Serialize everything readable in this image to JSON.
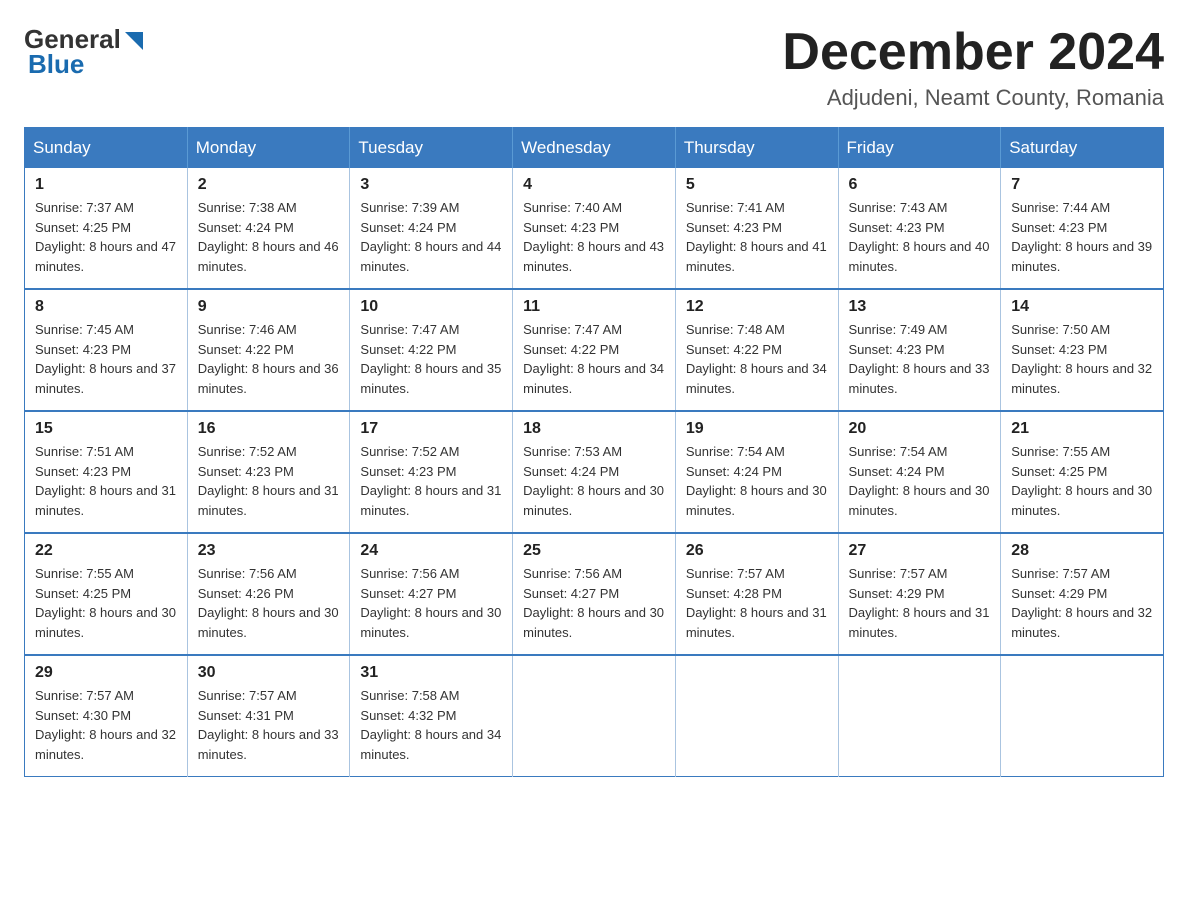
{
  "header": {
    "logo": {
      "general": "General",
      "blue": "Blue"
    },
    "title": "December 2024",
    "location": "Adjudeni, Neamt County, Romania"
  },
  "calendar": {
    "days_of_week": [
      "Sunday",
      "Monday",
      "Tuesday",
      "Wednesday",
      "Thursday",
      "Friday",
      "Saturday"
    ],
    "weeks": [
      [
        {
          "day": "1",
          "sunrise": "7:37 AM",
          "sunset": "4:25 PM",
          "daylight": "8 hours and 47 minutes."
        },
        {
          "day": "2",
          "sunrise": "7:38 AM",
          "sunset": "4:24 PM",
          "daylight": "8 hours and 46 minutes."
        },
        {
          "day": "3",
          "sunrise": "7:39 AM",
          "sunset": "4:24 PM",
          "daylight": "8 hours and 44 minutes."
        },
        {
          "day": "4",
          "sunrise": "7:40 AM",
          "sunset": "4:23 PM",
          "daylight": "8 hours and 43 minutes."
        },
        {
          "day": "5",
          "sunrise": "7:41 AM",
          "sunset": "4:23 PM",
          "daylight": "8 hours and 41 minutes."
        },
        {
          "day": "6",
          "sunrise": "7:43 AM",
          "sunset": "4:23 PM",
          "daylight": "8 hours and 40 minutes."
        },
        {
          "day": "7",
          "sunrise": "7:44 AM",
          "sunset": "4:23 PM",
          "daylight": "8 hours and 39 minutes."
        }
      ],
      [
        {
          "day": "8",
          "sunrise": "7:45 AM",
          "sunset": "4:23 PM",
          "daylight": "8 hours and 37 minutes."
        },
        {
          "day": "9",
          "sunrise": "7:46 AM",
          "sunset": "4:22 PM",
          "daylight": "8 hours and 36 minutes."
        },
        {
          "day": "10",
          "sunrise": "7:47 AM",
          "sunset": "4:22 PM",
          "daylight": "8 hours and 35 minutes."
        },
        {
          "day": "11",
          "sunrise": "7:47 AM",
          "sunset": "4:22 PM",
          "daylight": "8 hours and 34 minutes."
        },
        {
          "day": "12",
          "sunrise": "7:48 AM",
          "sunset": "4:22 PM",
          "daylight": "8 hours and 34 minutes."
        },
        {
          "day": "13",
          "sunrise": "7:49 AM",
          "sunset": "4:23 PM",
          "daylight": "8 hours and 33 minutes."
        },
        {
          "day": "14",
          "sunrise": "7:50 AM",
          "sunset": "4:23 PM",
          "daylight": "8 hours and 32 minutes."
        }
      ],
      [
        {
          "day": "15",
          "sunrise": "7:51 AM",
          "sunset": "4:23 PM",
          "daylight": "8 hours and 31 minutes."
        },
        {
          "day": "16",
          "sunrise": "7:52 AM",
          "sunset": "4:23 PM",
          "daylight": "8 hours and 31 minutes."
        },
        {
          "day": "17",
          "sunrise": "7:52 AM",
          "sunset": "4:23 PM",
          "daylight": "8 hours and 31 minutes."
        },
        {
          "day": "18",
          "sunrise": "7:53 AM",
          "sunset": "4:24 PM",
          "daylight": "8 hours and 30 minutes."
        },
        {
          "day": "19",
          "sunrise": "7:54 AM",
          "sunset": "4:24 PM",
          "daylight": "8 hours and 30 minutes."
        },
        {
          "day": "20",
          "sunrise": "7:54 AM",
          "sunset": "4:24 PM",
          "daylight": "8 hours and 30 minutes."
        },
        {
          "day": "21",
          "sunrise": "7:55 AM",
          "sunset": "4:25 PM",
          "daylight": "8 hours and 30 minutes."
        }
      ],
      [
        {
          "day": "22",
          "sunrise": "7:55 AM",
          "sunset": "4:25 PM",
          "daylight": "8 hours and 30 minutes."
        },
        {
          "day": "23",
          "sunrise": "7:56 AM",
          "sunset": "4:26 PM",
          "daylight": "8 hours and 30 minutes."
        },
        {
          "day": "24",
          "sunrise": "7:56 AM",
          "sunset": "4:27 PM",
          "daylight": "8 hours and 30 minutes."
        },
        {
          "day": "25",
          "sunrise": "7:56 AM",
          "sunset": "4:27 PM",
          "daylight": "8 hours and 30 minutes."
        },
        {
          "day": "26",
          "sunrise": "7:57 AM",
          "sunset": "4:28 PM",
          "daylight": "8 hours and 31 minutes."
        },
        {
          "day": "27",
          "sunrise": "7:57 AM",
          "sunset": "4:29 PM",
          "daylight": "8 hours and 31 minutes."
        },
        {
          "day": "28",
          "sunrise": "7:57 AM",
          "sunset": "4:29 PM",
          "daylight": "8 hours and 32 minutes."
        }
      ],
      [
        {
          "day": "29",
          "sunrise": "7:57 AM",
          "sunset": "4:30 PM",
          "daylight": "8 hours and 32 minutes."
        },
        {
          "day": "30",
          "sunrise": "7:57 AM",
          "sunset": "4:31 PM",
          "daylight": "8 hours and 33 minutes."
        },
        {
          "day": "31",
          "sunrise": "7:58 AM",
          "sunset": "4:32 PM",
          "daylight": "8 hours and 34 minutes."
        },
        null,
        null,
        null,
        null
      ]
    ]
  }
}
